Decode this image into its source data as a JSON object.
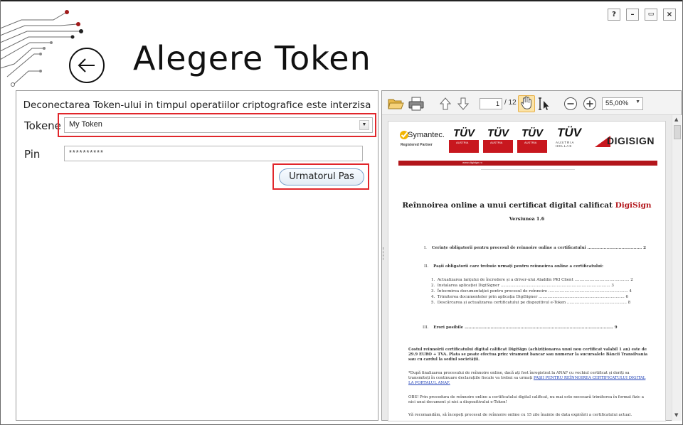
{
  "window": {
    "controls": {
      "help": "?",
      "minimize": "–",
      "maximize": "▭",
      "close": "×"
    }
  },
  "header": {
    "title": "Alegere Token",
    "back_icon": "arrow-left-circle-icon"
  },
  "form": {
    "warning": "Deconectarea Token-ului in timpul operatiilor criptografice este interzisa",
    "token_label": "Tokene",
    "token_value": "My Token",
    "pin_label": "Pin",
    "pin_value": "**********",
    "next_button": "Urmatorul Pas",
    "highlight_color": "#e1262b"
  },
  "viewer": {
    "toolbar": {
      "open_icon": "folder-open-icon",
      "print_icon": "printer-icon",
      "prev_icon": "arrow-up-icon",
      "next_icon": "arrow-down-icon",
      "page_current": "1",
      "page_total": "/ 12",
      "hand_icon": "hand-icon",
      "select_icon": "text-select-icon",
      "zoom_out_icon": "zoom-out-icon",
      "zoom_in_icon": "zoom-in-icon",
      "zoom_value": "55,00%"
    },
    "document": {
      "logos": {
        "symantec": "Symantec.",
        "symantec_sub": "Registered Partner",
        "tuv": "TÜV",
        "austria": "AUSTRIA",
        "hellas": "AUSTRIA HELLAS",
        "digisign": "DIGISIGN"
      },
      "web_strip": "www.digisign.ro",
      "title_part1": "Reînnoirea online a unui certificat digital calificat ",
      "title_part2": "DigiSign",
      "version": "Versiunea 1.6",
      "toc": [
        {
          "num": "I.",
          "text": "Cerințe obligatorii pentru procesul de reînnoire online a certificatului ........................................ 2"
        },
        {
          "num": "II.",
          "text": "Pașii obligatorii care trebuie urmați pentru reînnoirea online a certificatului:"
        },
        {
          "num": "1.",
          "text": "Actualizarea lanțului de încredere și a driver-ului Aladdin PKI Client ............................................ 2"
        },
        {
          "num": "2.",
          "text": "Instalarea aplicației DigiSigner ........................................................................................ 3"
        },
        {
          "num": "3.",
          "text": "Întocmirea documentației pentru procesul de reînnoire ................................................................ 4"
        },
        {
          "num": "4.",
          "text": "Trimiterea documentelor prin aplicația DigiSigner ..................................................................... 6"
        },
        {
          "num": "5.",
          "text": "Descărcarea și actualizarea certificatului pe dispozitivul e-Token ................................................ 8"
        },
        {
          "num": "III.",
          "text": "Erori posibile ............................................................................................................. 9"
        }
      ],
      "para1": "Costul reînnoirii certificatului digital calificat DigiSign (achiziționarea unui nou certificat valabil 1 an) este de 29.9 EURO + TVA. Plata se poate efectua prin: virament bancar sau numerar la sucursalele Băncii Transilvania sau cu cardul la sediul societății.",
      "para2a": "*După finalizarea procesului de reînnoire online, dacă ați fost înregistrat la ANAF cu vechiul certificat și doriți sa transmiteți în continuare declarațiile fiscale va trebui sa urmați ",
      "para2b": "PAȘII PENTRU REÎNNOIREA CERTIFICATULUI DIGITAL LA PORTALUL ANAF.",
      "para3": "OBS! Prin procedura de reînnoire online a certificatului digital calificat, nu mai este necesară trimiterea în format fizic a nici unui document și nici a dispozitivului e-Token!",
      "para4": "Vă recomandăm, să începeți procesul de reînnoire online cu 15 zile înainte de data expirării a certificatului actual."
    }
  }
}
